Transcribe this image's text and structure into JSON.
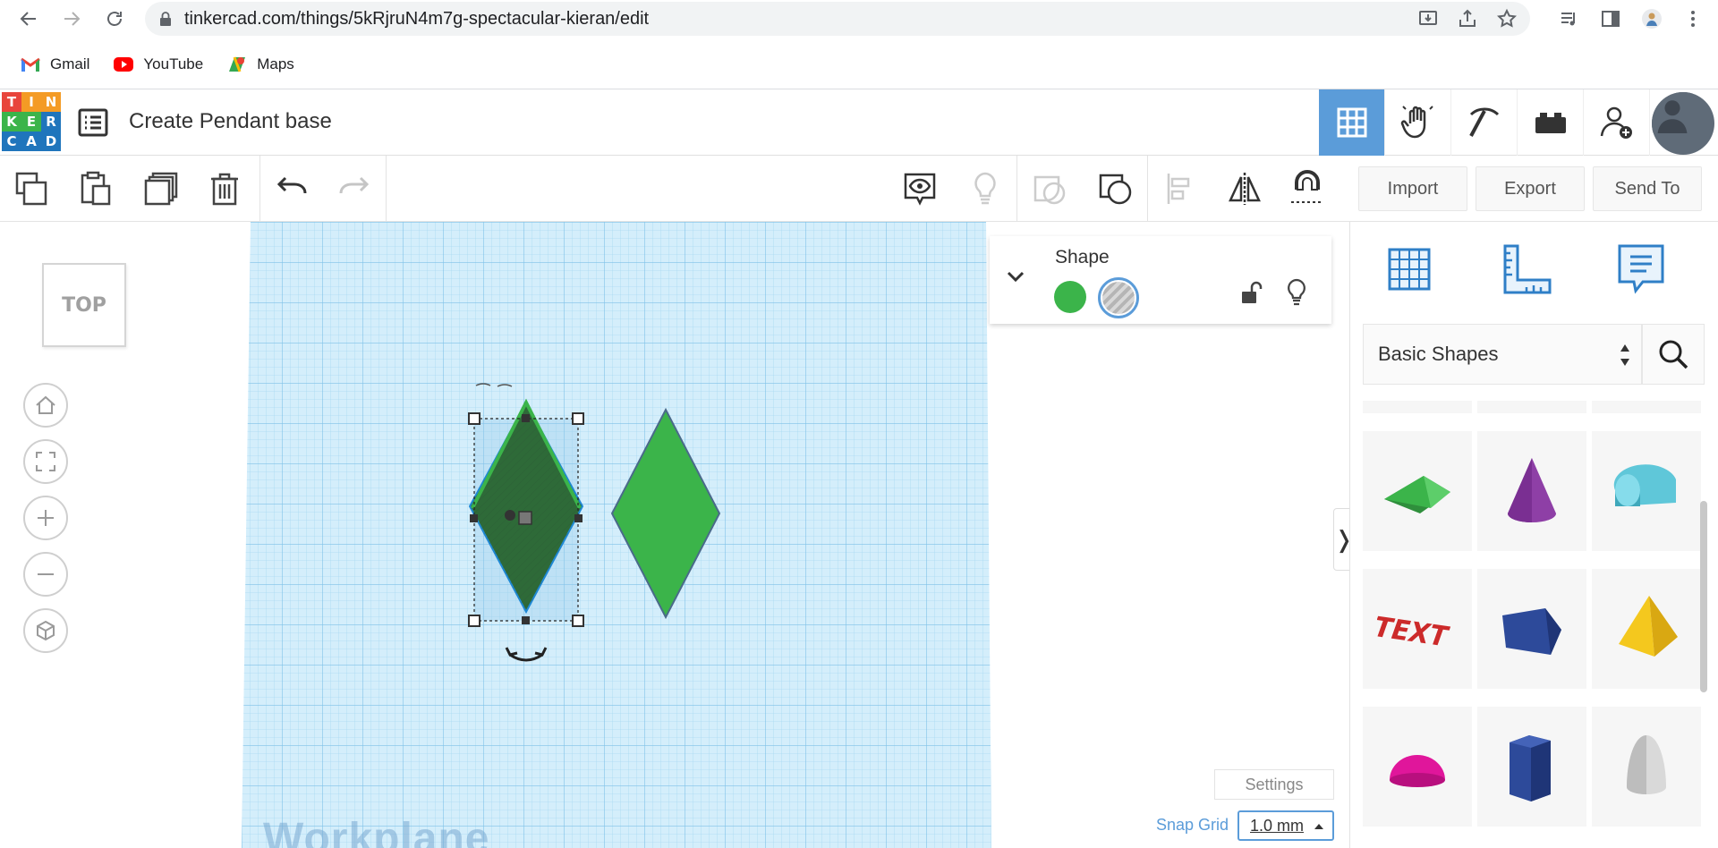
{
  "browser": {
    "url": "tinkercad.com/things/5kRjruN4m7g-spectacular-kieran/edit",
    "bookmarks": [
      {
        "label": "Gmail",
        "icon": "gmail-icon"
      },
      {
        "label": "YouTube",
        "icon": "youtube-icon"
      },
      {
        "label": "Maps",
        "icon": "maps-icon"
      }
    ]
  },
  "app": {
    "logo_letters": [
      "T",
      "I",
      "N",
      "K",
      "E",
      "R",
      "C",
      "A",
      "D"
    ],
    "logo_colors": [
      "#e8453c",
      "#f49b25",
      "#f49b25",
      "#3bb44a",
      "#3bb44a",
      "#1f75bc",
      "#1f75bc",
      "#1f75bc",
      "#1f75bc"
    ],
    "design_title": "Create Pendant base",
    "accent": "#5b9cd9"
  },
  "toolbar": {
    "import_label": "Import",
    "export_label": "Export",
    "send_to_label": "Send To"
  },
  "view": {
    "cube_label": "TOP"
  },
  "workplane": {
    "label": "Workplane",
    "grid_color": "#bfe3f7",
    "shape_color": "#3bb44a"
  },
  "inspector": {
    "title": "Shape",
    "solid_color": "#3bb44a"
  },
  "settings": {
    "settings_label": "Settings",
    "snap_label": "Snap Grid",
    "snap_value": "1.0 mm"
  },
  "shapes_panel": {
    "category": "Basic Shapes",
    "shapes": [
      {
        "name": "roof",
        "color": "#3bb44a"
      },
      {
        "name": "cone",
        "color": "#8e3fa6"
      },
      {
        "name": "round-roof",
        "color": "#5fc7d9"
      },
      {
        "name": "text",
        "color": "#cc2a2a"
      },
      {
        "name": "polygon",
        "color": "#2d4a9a"
      },
      {
        "name": "pyramid",
        "color": "#f4c81e"
      },
      {
        "name": "half-sphere",
        "color": "#e0169b"
      },
      {
        "name": "hexagonal-prism",
        "color": "#2d4a9a"
      },
      {
        "name": "paraboloid",
        "color": "#d9d9d9"
      }
    ]
  }
}
